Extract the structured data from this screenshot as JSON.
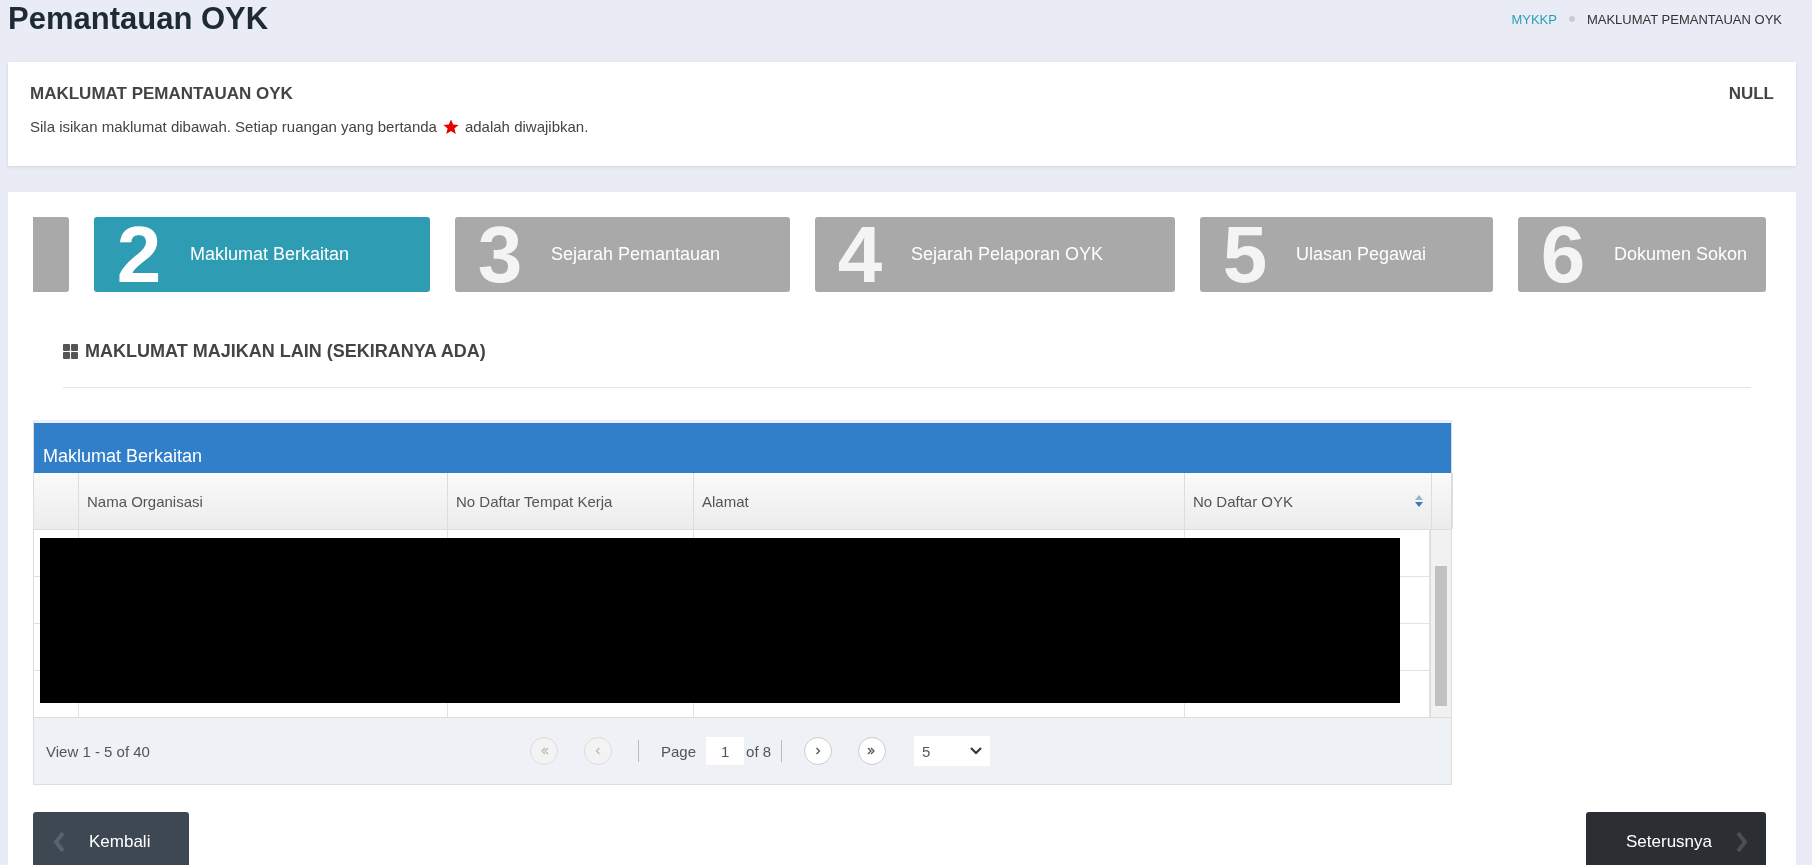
{
  "page_title": "Pemantauan OYK",
  "breadcrumb": [
    {
      "label": "MYKKP",
      "link": true
    },
    {
      "label": "MAKLUMAT PEMANTAUAN OYK",
      "link": false
    }
  ],
  "info_card": {
    "title": "MAKLUMAT PEMANTAUAN OYK",
    "status": "NULL",
    "instruction_before": "Sila isikan maklumat dibawah. Setiap ruangan yang bertanda",
    "instruction_after": "adalah diwajibkan."
  },
  "steps": [
    {
      "number": "2",
      "label": "Maklumat Berkaitan",
      "selected": true
    },
    {
      "number": "3",
      "label": "Sejarah Pemantauan",
      "selected": false
    },
    {
      "number": "4",
      "label": "Sejarah Pelaporan OYK",
      "selected": false
    },
    {
      "number": "5",
      "label": "Ulasan Pegawai",
      "selected": false
    },
    {
      "number": "6",
      "label": "Dokumen Sokon",
      "selected": false
    }
  ],
  "section_heading": "MAKLUMAT MAJIKAN LAIN (SEKIRANYA ADA)",
  "table": {
    "caption": "Maklumat Berkaitan",
    "columns": [
      {
        "label": "Nama Organisasi",
        "sortable": false
      },
      {
        "label": "No Daftar Tempat Kerja",
        "sortable": false
      },
      {
        "label": "Alamat",
        "sortable": false
      },
      {
        "label": "No Daftar OYK",
        "sortable": true
      }
    ],
    "redacted": true
  },
  "pager": {
    "view_text": "View 1 - 5 of 40",
    "page_label": "Page",
    "page_value": "1",
    "of_text": "of 8",
    "page_size": "5",
    "buttons": [
      {
        "kind": "first",
        "disabled": true
      },
      {
        "kind": "prev",
        "disabled": true
      },
      {
        "kind": "next",
        "disabled": false
      },
      {
        "kind": "last",
        "disabled": false
      }
    ]
  },
  "back_button": "Kembali",
  "next_button": "Seterusnya"
}
